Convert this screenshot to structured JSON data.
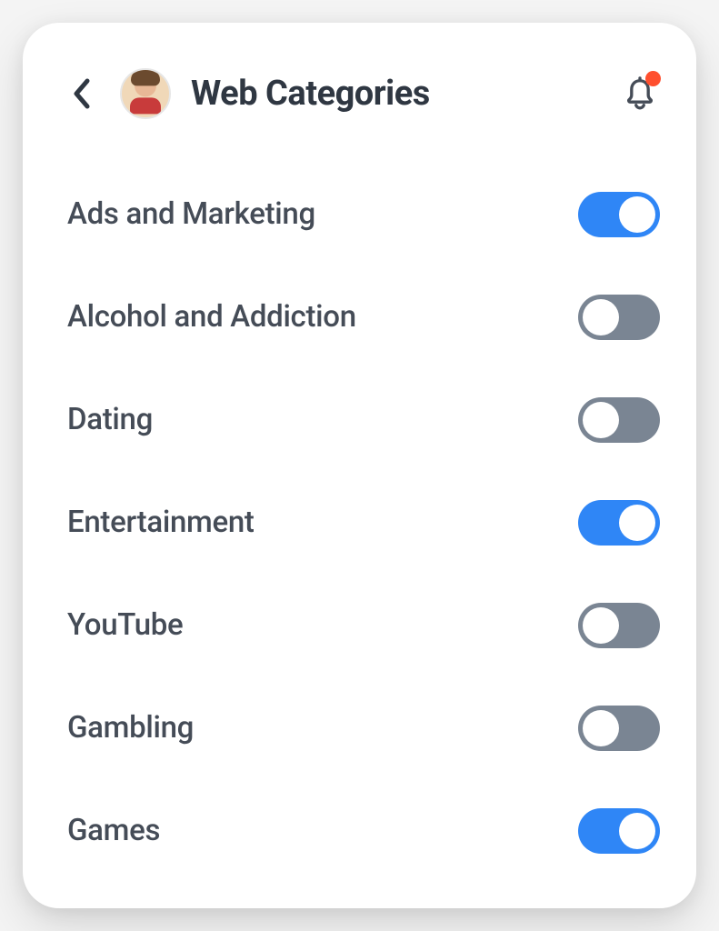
{
  "header": {
    "title": "Web Categories",
    "notification_dot_color": "#ff4f2e"
  },
  "colors": {
    "toggle_on": "#2f86f6",
    "toggle_off": "#7a8593",
    "text_primary": "#2f3742",
    "text_secondary": "#454c57"
  },
  "categories": [
    {
      "label": "Ads and Marketing",
      "enabled": true
    },
    {
      "label": "Alcohol and Addiction",
      "enabled": false
    },
    {
      "label": "Dating",
      "enabled": false
    },
    {
      "label": "Entertainment",
      "enabled": true
    },
    {
      "label": "YouTube",
      "enabled": false
    },
    {
      "label": "Gambling",
      "enabled": false
    },
    {
      "label": "Games",
      "enabled": true
    }
  ]
}
